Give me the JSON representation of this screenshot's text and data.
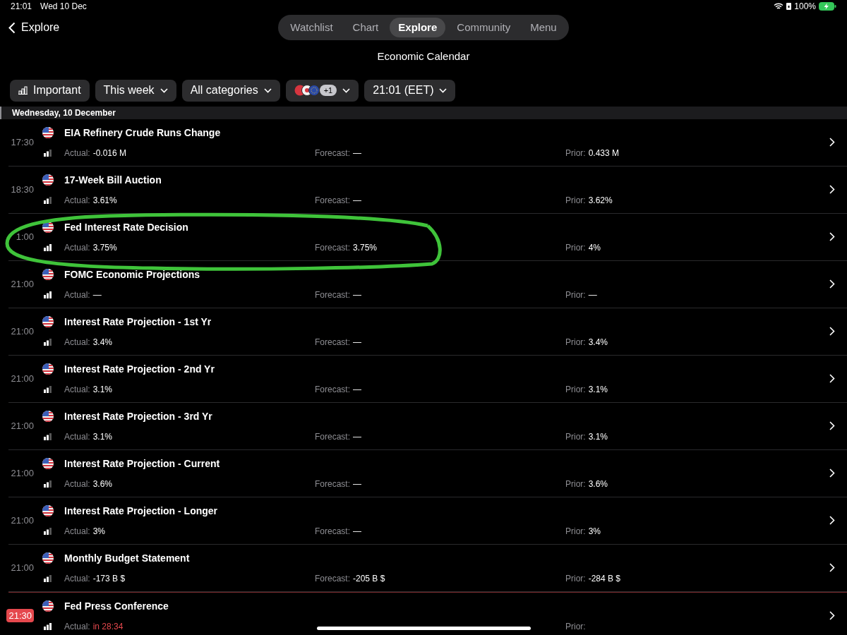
{
  "status_bar": {
    "time": "21:01",
    "date": "Wed 10 Dec",
    "battery": "100%"
  },
  "nav": {
    "back": "Explore",
    "tabs": [
      {
        "label": "Watchlist",
        "selected": false
      },
      {
        "label": "Chart",
        "selected": false
      },
      {
        "label": "Explore",
        "selected": true
      },
      {
        "label": "Community",
        "selected": false
      },
      {
        "label": "Menu",
        "selected": false
      }
    ]
  },
  "title": "Economic Calendar",
  "filters": [
    {
      "kind": "toggle",
      "label": "Important"
    },
    {
      "kind": "dropdown",
      "label": "This week"
    },
    {
      "kind": "dropdown",
      "label": "All categories"
    },
    {
      "kind": "regions",
      "badge": "+1"
    },
    {
      "kind": "dropdown",
      "label": "21:01 (EET)"
    }
  ],
  "section": "Wednesday, 10 December",
  "events": [
    {
      "time": "17:30",
      "live": false,
      "high_importance": false,
      "name": "EIA Refinery Crude Runs Change",
      "actual_label": "Actual:",
      "actual": "-0.016 M",
      "forecast_label": "Forecast:",
      "forecast": "—",
      "prior_label": "Prior:",
      "prior": "0.433 M"
    },
    {
      "time": "18:30",
      "live": false,
      "high_importance": false,
      "name": "17-Week Bill Auction",
      "actual_label": "Actual:",
      "actual": "3.61%",
      "forecast_label": "Forecast:",
      "forecast": "—",
      "prior_label": "Prior:",
      "prior": "3.62%"
    },
    {
      "time": "1:00",
      "live": false,
      "high_importance": true,
      "name": "Fed Interest Rate Decision",
      "actual_label": "Actual:",
      "actual": "3.75%",
      "forecast_label": "Forecast:",
      "forecast": "3.75%",
      "prior_label": "Prior:",
      "prior": "4%"
    },
    {
      "time": "21:00",
      "live": false,
      "high_importance": true,
      "name": "FOMC Economic Projections",
      "actual_label": "Actual:",
      "actual": "—",
      "forecast_label": "Forecast:",
      "forecast": "—",
      "prior_label": "Prior:",
      "prior": "—"
    },
    {
      "time": "21:00",
      "live": false,
      "high_importance": false,
      "name": "Interest Rate Projection - 1st Yr",
      "actual_label": "Actual:",
      "actual": "3.4%",
      "forecast_label": "Forecast:",
      "forecast": "—",
      "prior_label": "Prior:",
      "prior": "3.4%"
    },
    {
      "time": "21:00",
      "live": false,
      "high_importance": false,
      "name": "Interest Rate Projection - 2nd Yr",
      "actual_label": "Actual:",
      "actual": "3.1%",
      "forecast_label": "Forecast:",
      "forecast": "—",
      "prior_label": "Prior:",
      "prior": "3.1%"
    },
    {
      "time": "21:00",
      "live": false,
      "high_importance": false,
      "name": "Interest Rate Projection - 3rd Yr",
      "actual_label": "Actual:",
      "actual": "3.1%",
      "forecast_label": "Forecast:",
      "forecast": "—",
      "prior_label": "Prior:",
      "prior": "3.1%"
    },
    {
      "time": "21:00",
      "live": false,
      "high_importance": false,
      "name": "Interest Rate Projection - Current",
      "actual_label": "Actual:",
      "actual": "3.6%",
      "forecast_label": "Forecast:",
      "forecast": "—",
      "prior_label": "Prior:",
      "prior": "3.6%"
    },
    {
      "time": "21:00",
      "live": false,
      "high_importance": false,
      "name": "Interest Rate Projection - Longer",
      "actual_label": "Actual:",
      "actual": "3%",
      "forecast_label": "Forecast:",
      "forecast": "—",
      "prior_label": "Prior:",
      "prior": "3%"
    },
    {
      "time": "21:00",
      "live": false,
      "high_importance": false,
      "name": "Monthly Budget Statement",
      "actual_label": "Actual:",
      "actual": "-173 B $",
      "forecast_label": "Forecast:",
      "forecast": "-205 B $",
      "prior_label": "Prior:",
      "prior": "-284 B $"
    },
    {
      "time": "21:30",
      "live": true,
      "high_importance": true,
      "name": "Fed Press Conference",
      "actual_label": "Actual:",
      "actual": "in 28:34",
      "prior_label": "Prior:"
    }
  ]
}
